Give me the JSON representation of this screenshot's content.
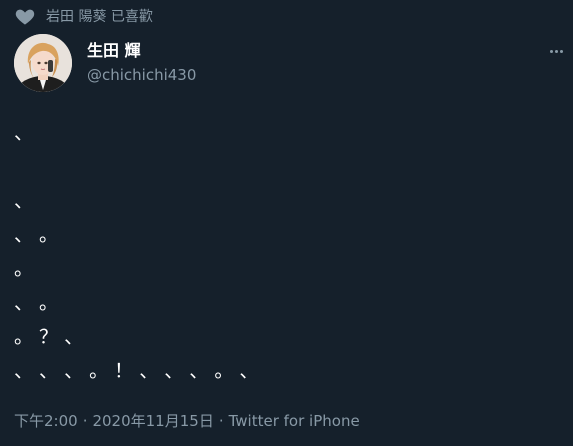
{
  "social_context": {
    "icon": "heart-icon",
    "text": "岩田 陽葵 已喜歡"
  },
  "author": {
    "name": "生田 輝",
    "handle": "@chichichi430",
    "avatar": "avatar"
  },
  "tweet": {
    "lines": [
      "、",
      "",
      "、",
      "、 。",
      "。",
      "、 。",
      "。 ？ 、",
      "、 、 、 。 ！ 、 、 、 。 、"
    ]
  },
  "meta": {
    "time": "下午2:00",
    "separator": "·",
    "date": "2020年11月15日",
    "source": "Twitter for iPhone"
  },
  "colors": {
    "background": "#15202b",
    "text": "#ffffff",
    "secondary": "#8899a6"
  }
}
